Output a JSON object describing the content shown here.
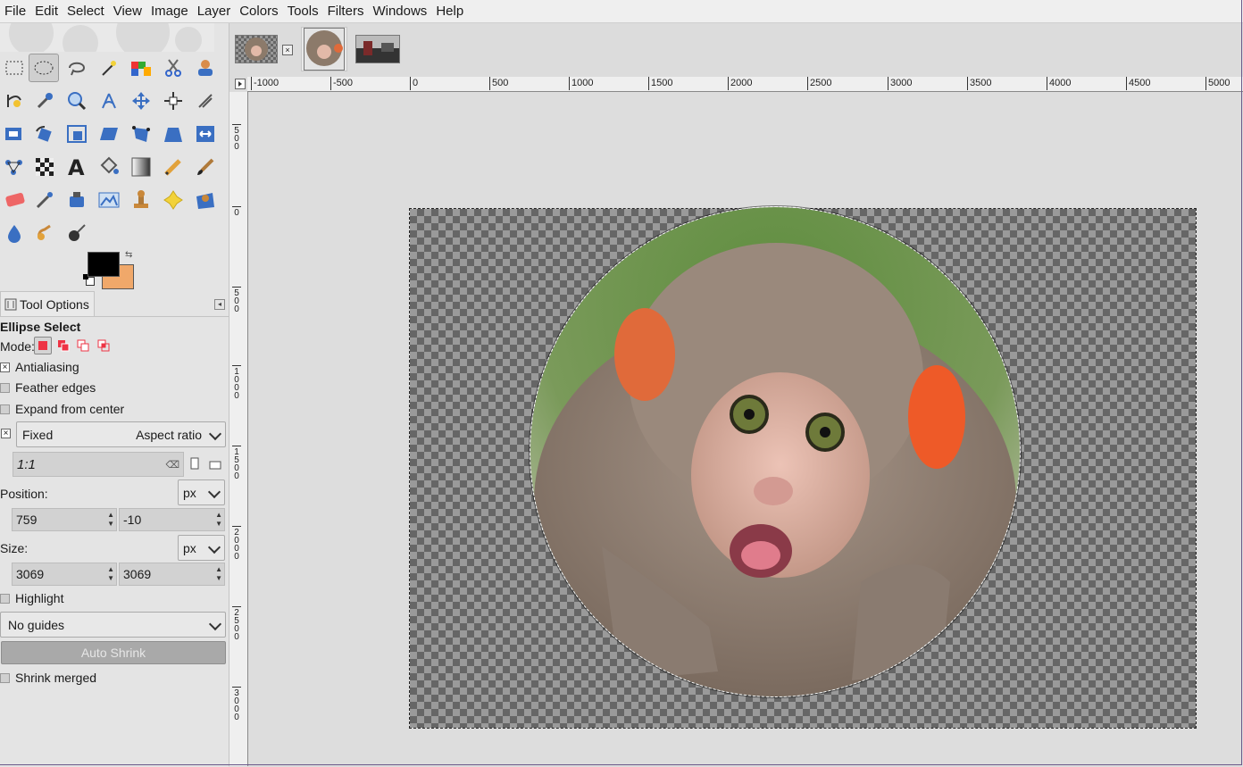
{
  "menu": [
    "File",
    "Edit",
    "Select",
    "View",
    "Image",
    "Layer",
    "Colors",
    "Tools",
    "Filters",
    "Windows",
    "Help"
  ],
  "tool_options": {
    "tab_label": "Tool Options",
    "title": "Ellipse Select",
    "mode_label": "Mode:",
    "antialiasing": "Antialiasing",
    "feather_edges": "Feather edges",
    "expand_from_center": "Expand from center",
    "fixed_label": "Fixed",
    "fixed_option": "Aspect ratio",
    "ratio_value": "1:1",
    "position_label": "Position:",
    "position_unit": "px",
    "position_x": "759",
    "position_y": "-10",
    "size_label": "Size:",
    "size_unit": "px",
    "size_w": "3069",
    "size_h": "3069",
    "highlight": "Highlight",
    "guides": "No guides",
    "auto_shrink": "Auto Shrink",
    "shrink_merged": "Shrink merged"
  },
  "colors": {
    "foreground": "#000000",
    "background": "#f0a86a"
  },
  "hruler": [
    "-1000",
    "-500",
    "0",
    "500",
    "1000",
    "1500",
    "2000",
    "2500",
    "3000",
    "3500",
    "4000",
    "4500",
    "5000"
  ],
  "vruler": [
    "500",
    "0",
    "500",
    "1000",
    "1500",
    "2000",
    "2500",
    "3000"
  ]
}
